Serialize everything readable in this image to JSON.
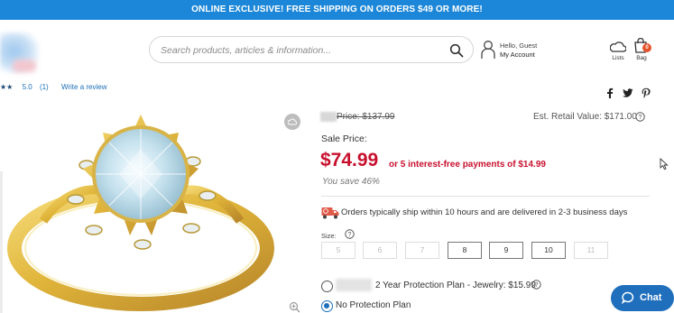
{
  "promo_banner": "ONLINE EXCLUSIVE! FREE SHIPPING ON ORDERS $49 OR MORE!",
  "search": {
    "placeholder": "Search products, articles & information..."
  },
  "account": {
    "line1": "Hello, Guest",
    "line2": "My Account"
  },
  "lists": {
    "label": "Lists"
  },
  "bag": {
    "label": "Bag",
    "count": "0"
  },
  "rating": {
    "stars": "★★",
    "score": "5.0",
    "count": "(1)",
    "write_review": "Write a review"
  },
  "share": [
    "facebook-icon",
    "twitter-icon",
    "pinterest-icon"
  ],
  "pricing": {
    "original": "Price: $137.99",
    "retail": "Est. Retail Value: $171.00",
    "sale_label": "Sale Price:",
    "sale_price": "$74.99",
    "installments": "or 5 interest-free payments of $14.99",
    "savings": "You save 46%"
  },
  "shipping": {
    "text": "Orders typically ship within 10 hours and are delivered in 2-3 business days"
  },
  "size": {
    "label": "Size:",
    "options": [
      {
        "label": "5",
        "available": false
      },
      {
        "label": "6",
        "available": false
      },
      {
        "label": "7",
        "available": false
      },
      {
        "label": "8",
        "available": true
      },
      {
        "label": "9",
        "available": true
      },
      {
        "label": "10",
        "available": true
      },
      {
        "label": "11",
        "available": false
      }
    ]
  },
  "protection": {
    "plan1": "2 Year Protection Plan - Jewelry: $15.99",
    "plan2": "No Protection Plan",
    "selected": "No Protection Plan"
  },
  "chat": {
    "label": "Chat"
  },
  "colors": {
    "banner": "#1c87d8",
    "sale": "#c8102e",
    "chat": "#1f6fbd"
  }
}
